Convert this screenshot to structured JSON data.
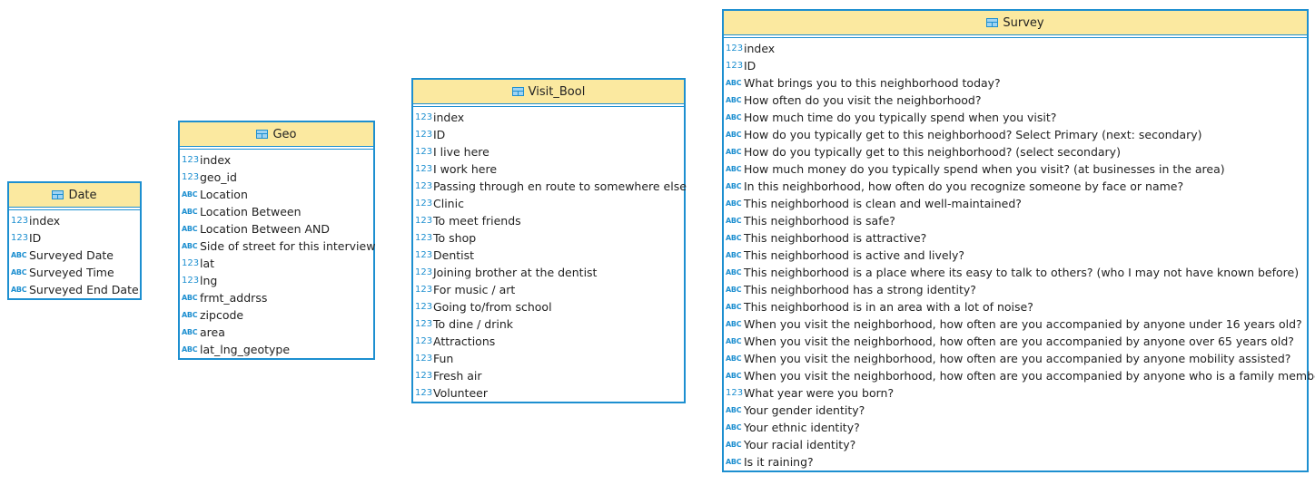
{
  "entities": [
    {
      "name": "Date",
      "columns": [
        {
          "type": "123",
          "label": "index"
        },
        {
          "type": "123",
          "label": "ID"
        },
        {
          "type": "ABC",
          "label": "Surveyed Date"
        },
        {
          "type": "ABC",
          "label": "Surveyed Time"
        },
        {
          "type": "ABC",
          "label": "Surveyed End Date"
        }
      ]
    },
    {
      "name": "Geo",
      "columns": [
        {
          "type": "123",
          "label": "index"
        },
        {
          "type": "123",
          "label": "geo_id"
        },
        {
          "type": "ABC",
          "label": "Location"
        },
        {
          "type": "ABC",
          "label": "Location Between"
        },
        {
          "type": "ABC",
          "label": "Location Between AND"
        },
        {
          "type": "ABC",
          "label": "Side of street for this interview"
        },
        {
          "type": "123",
          "label": "lat"
        },
        {
          "type": "123",
          "label": "lng"
        },
        {
          "type": "ABC",
          "label": "frmt_addrss"
        },
        {
          "type": "ABC",
          "label": "zipcode"
        },
        {
          "type": "ABC",
          "label": "area"
        },
        {
          "type": "ABC",
          "label": "lat_lng_geotype"
        }
      ]
    },
    {
      "name": "Visit_Bool",
      "columns": [
        {
          "type": "123",
          "label": "index"
        },
        {
          "type": "123",
          "label": "ID"
        },
        {
          "type": "123",
          "label": "I live here"
        },
        {
          "type": "123",
          "label": "I work here"
        },
        {
          "type": "123",
          "label": "Passing through en route to somewhere else"
        },
        {
          "type": "123",
          "label": "Clinic"
        },
        {
          "type": "123",
          "label": "To meet friends"
        },
        {
          "type": "123",
          "label": "To shop"
        },
        {
          "type": "123",
          "label": "Dentist"
        },
        {
          "type": "123",
          "label": "Joining brother at the dentist"
        },
        {
          "type": "123",
          "label": "For music / art"
        },
        {
          "type": "123",
          "label": "Going to/from school"
        },
        {
          "type": "123",
          "label": "To dine / drink"
        },
        {
          "type": "123",
          "label": "Attractions"
        },
        {
          "type": "123",
          "label": "Fun"
        },
        {
          "type": "123",
          "label": "Fresh air"
        },
        {
          "type": "123",
          "label": "Volunteer"
        }
      ]
    },
    {
      "name": "Survey",
      "columns": [
        {
          "type": "123",
          "label": "index"
        },
        {
          "type": "123",
          "label": "ID"
        },
        {
          "type": "ABC",
          "label": "What brings you to this neighborhood today?"
        },
        {
          "type": "ABC",
          "label": "How often do you visit the neighborhood?"
        },
        {
          "type": "ABC",
          "label": "How much time do you typically spend when you visit?"
        },
        {
          "type": "ABC",
          "label": "How do you typically get to this neighborhood? Select Primary (next: secondary)"
        },
        {
          "type": "ABC",
          "label": "How do you typically get to this neighborhood? (select secondary)"
        },
        {
          "type": "ABC",
          "label": "How much money do you typically spend when you visit? (at businesses in the area)"
        },
        {
          "type": "ABC",
          "label": "In this neighborhood, how often do you recognize someone by face or name?"
        },
        {
          "type": "ABC",
          "label": "This neighborhood is clean and well-maintained?"
        },
        {
          "type": "ABC",
          "label": "This neighborhood is safe?"
        },
        {
          "type": "ABC",
          "label": "This neighborhood is attractive?"
        },
        {
          "type": "ABC",
          "label": "This neighborhood is active and lively?"
        },
        {
          "type": "ABC",
          "label": "This neighborhood is a place where its easy to talk to others? (who I may not have known before)"
        },
        {
          "type": "ABC",
          "label": "This neighborhood has a strong identity?"
        },
        {
          "type": "ABC",
          "label": "This neighborhood is in an area with a lot of noise?"
        },
        {
          "type": "ABC",
          "label": "When you visit the neighborhood, how often are you accompanied by anyone under 16 years old?"
        },
        {
          "type": "ABC",
          "label": "When you visit the neighborhood, how often are you accompanied by anyone over 65 years old?"
        },
        {
          "type": "ABC",
          "label": "When you visit the neighborhood, how often are you accompanied by anyone mobility assisted?"
        },
        {
          "type": "ABC",
          "label": "When you visit the neighborhood, how often are you accompanied by anyone who is a family member?"
        },
        {
          "type": "123",
          "label": "What year were you born?"
        },
        {
          "type": "ABC",
          "label": "Your gender identity?"
        },
        {
          "type": "ABC",
          "label": "Your ethnic identity?"
        },
        {
          "type": "ABC",
          "label": "Your racial identity?"
        },
        {
          "type": "ABC",
          "label": "Is it raining?"
        }
      ]
    }
  ],
  "colors": {
    "border": "#1d8fd0",
    "header": "#fbe9a0",
    "type_icon": "#1d8fd0"
  }
}
